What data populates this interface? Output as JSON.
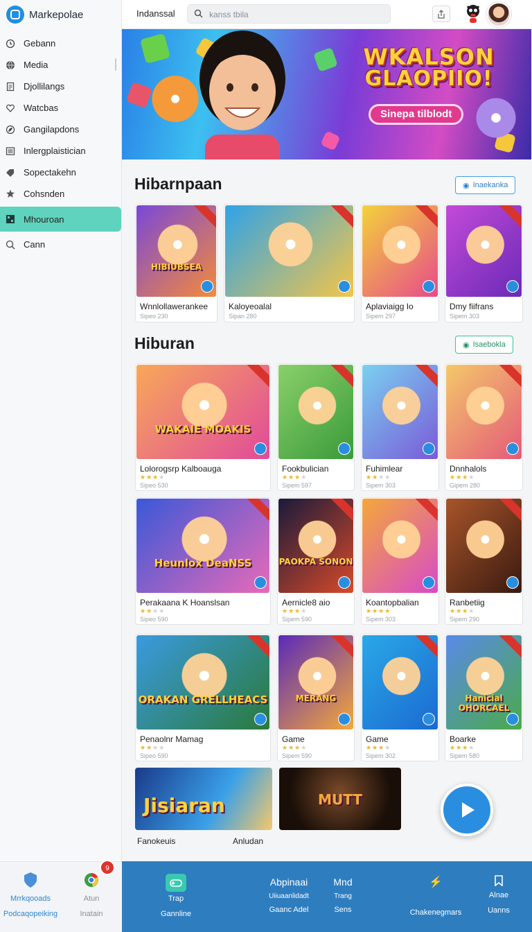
{
  "app": {
    "name": "Markepolae"
  },
  "sidebar": {
    "items": [
      {
        "label": "Gebann",
        "icon": "clock-icon"
      },
      {
        "label": "Media",
        "icon": "globe-icon"
      },
      {
        "label": "Djollilangs",
        "icon": "document-icon"
      },
      {
        "label": "Watcbas",
        "icon": "heart-icon"
      },
      {
        "label": "Gangilapdons",
        "icon": "leaf-icon"
      },
      {
        "label": "Inlergplaistician",
        "icon": "list-icon"
      },
      {
        "label": "Sopectakehn",
        "icon": "tag-icon"
      },
      {
        "label": "Cohsnden",
        "icon": "gear-icon"
      },
      {
        "label": "Mhouroan",
        "icon": "grid-icon"
      },
      {
        "label": "Cann",
        "icon": "search-icon"
      }
    ],
    "active_index": 8
  },
  "topbar": {
    "title": "Indanssal",
    "search_placeholder": "kanss tbila"
  },
  "hero": {
    "title_line1": "WKALSON",
    "title_line2": "GLAOPIIO!",
    "pill": "Sinepa tilblodt"
  },
  "sections": [
    {
      "title": "Hibarnpaan",
      "see_all": "Inaekanka",
      "cards": [
        {
          "title": "Wnnlollawerankee",
          "sub": "Sipeo 230",
          "thumb_text": "HIBIUBSEA",
          "colors": [
            "#7a48d8",
            "#f48a3a"
          ]
        },
        {
          "title": "Kaloyeoalal",
          "sub": "Sipan 280",
          "thumb_text": "",
          "colors": [
            "#2fa3e8",
            "#f4c548"
          ]
        },
        {
          "title": "Aplaviaigg Io",
          "sub": "Sipem 297",
          "thumb_text": "",
          "colors": [
            "#f4d23a",
            "#e74a8c"
          ]
        },
        {
          "title": "Dmy fiifrans",
          "sub": "Sipem 303",
          "thumb_text": "",
          "colors": [
            "#c44ad8",
            "#6a2ab8"
          ]
        }
      ]
    },
    {
      "title": "Hiburan",
      "see_all": "Isaebokla",
      "cards": [
        {
          "title": "Lolorogsrp Kalboauga",
          "sub": "Sipeo 530",
          "stars": 3,
          "thumb_text": "WAKAIE MOAKIS",
          "colors": [
            "#f8a85a",
            "#e04a9a"
          ]
        },
        {
          "title": "Fookbulician",
          "sub": "Sipem 597",
          "stars": 3,
          "thumb_text": "",
          "colors": [
            "#8ad06a",
            "#3a9a3a"
          ]
        },
        {
          "title": "Fuhimlear",
          "sub": "Sipem 303",
          "stars": 2,
          "thumb_text": "",
          "colors": [
            "#7ad0f0",
            "#7a5ad8"
          ]
        },
        {
          "title": "Dnnhalols",
          "sub": "Gipem 280",
          "stars": 3,
          "thumb_text": "",
          "colors": [
            "#f4c86a",
            "#e45a7a"
          ]
        },
        {
          "title": "Perakaana K Hoanslsan",
          "sub": "Sipeo 590",
          "stars": 2,
          "thumb_text": "Heunlox DeaNSS",
          "colors": [
            "#3a58d8",
            "#e86ab8"
          ]
        },
        {
          "title": "Aernicle8 aio",
          "sub": "Sipem 590",
          "stars": 3,
          "thumb_text": "PAOKPA SONON",
          "colors": [
            "#1a1a3a",
            "#d84a2a"
          ]
        },
        {
          "title": "Koantopbalian",
          "sub": "Sipem 303",
          "stars": 4,
          "thumb_text": "",
          "colors": [
            "#f4a83a",
            "#d84ac8"
          ]
        },
        {
          "title": "Ranbetiig",
          "sub": "Sipem 290",
          "stars": 3,
          "thumb_text": "",
          "colors": [
            "#a8552a",
            "#3a1a10"
          ]
        },
        {
          "title": "Penaolnr Mamag",
          "sub": "Sipeo 590",
          "stars": 2,
          "thumb_text": "ORAKAN GRELLHEACS",
          "colors": [
            "#3a9ae0",
            "#2a7a3a"
          ]
        },
        {
          "title": "Game",
          "sub": "Sipem 590",
          "stars": 3,
          "thumb_text": "MERANG",
          "colors": [
            "#5a2ab8",
            "#f4a83a"
          ]
        },
        {
          "title": "Game",
          "sub": "Sipem 302",
          "stars": 3,
          "thumb_text": "",
          "colors": [
            "#2aa8e8",
            "#1a6ad0"
          ]
        },
        {
          "title": "Boarke",
          "sub": "Sipem 580",
          "stars": 3,
          "thumb_text": "Hanicial OHORCAEL",
          "colors": [
            "#5a8ae8",
            "#4aaa4a"
          ]
        }
      ]
    }
  ],
  "featured": [
    {
      "label": "Fanokeuis",
      "thumb_text": "Jisiaran"
    },
    {
      "label": "Anludan",
      "thumb_text": "MUTT"
    }
  ],
  "bottom_left": [
    {
      "label": "Mrrkqooads",
      "sub": "Podcaqopeiking",
      "icon": "shield-icon"
    },
    {
      "label": "Atun",
      "sub": "Inatain",
      "icon": "chrome-icon"
    }
  ],
  "notification_count": "9",
  "bottom_bar": [
    {
      "label": "Trap",
      "sub": "Gannline",
      "icon": "gamepad-icon"
    },
    {
      "label": "Abpinaai",
      "sub": "Uiiuaanlidadt",
      "sub2": "Gaanc Adel"
    },
    {
      "label": "Mnd",
      "sub": "Trang",
      "sub2": "Sens"
    },
    {
      "label": "",
      "sub": "Chakenegmars",
      "icon": "bolt-icon"
    },
    {
      "label": "Alnae",
      "sub": "Uanns",
      "icon": "bookmark-icon"
    }
  ]
}
